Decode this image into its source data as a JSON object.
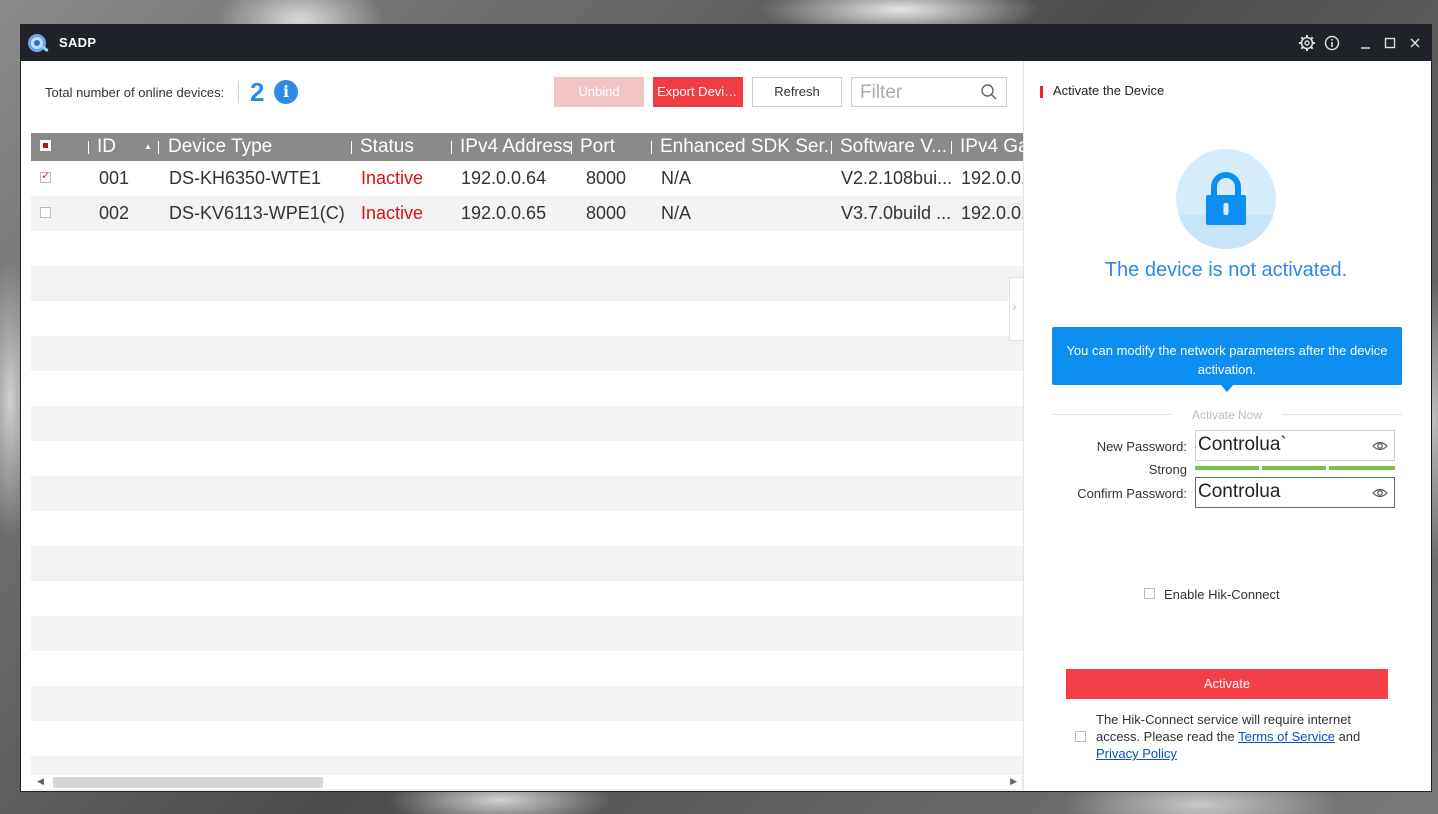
{
  "window": {
    "title": "SADP",
    "icons": [
      "gear-icon",
      "info-icon",
      "minimize-icon",
      "maximize-icon",
      "close-icon"
    ]
  },
  "toolbar": {
    "online_label": "Total number of online devices:",
    "online_count": "2",
    "unbind_label": "Unbind",
    "export_label": "Export Devic...",
    "refresh_label": "Refresh",
    "filter_placeholder": "Filter"
  },
  "table": {
    "columns": [
      "ID",
      "Device Type",
      "Status",
      "IPv4 Address",
      "Port",
      "Enhanced SDK Ser...",
      "Software V...",
      "IPv4 Ga"
    ],
    "rows": [
      {
        "checked": true,
        "id": "001",
        "device_type": "DS-KH6350-WTE1",
        "status": "Inactive",
        "ipv4": "192.0.0.64",
        "port": "8000",
        "sdk": "N/A",
        "software": "V2.2.108bui...",
        "gateway": "192.0.0."
      },
      {
        "checked": false,
        "id": "002",
        "device_type": "DS-KV6113-WPE1(C)",
        "status": "Inactive",
        "ipv4": "192.0.0.65",
        "port": "8000",
        "sdk": "N/A",
        "software": "V3.7.0build ...",
        "gateway": "192.0.0."
      }
    ]
  },
  "panel": {
    "title": "Activate the Device",
    "status_text": "The device is not activated.",
    "tip_text": "You can modify the network parameters after the device activation.",
    "activate_now_label": "Activate Now",
    "new_password_label": "New Password:",
    "new_password_value": "Controlua`",
    "strength_label": "Strong",
    "confirm_password_label": "Confirm Password:",
    "confirm_password_value": "Controlua",
    "hik_connect_label": "Enable Hik-Connect",
    "activate_button": "Activate",
    "notice_text": "The Hik-Connect service will require internet access. Please read the",
    "terms_link": "Terms of Service",
    "and_text": "and",
    "privacy_link": "Privacy Policy"
  },
  "colors": {
    "accent_blue": "#2a8ae6",
    "accent_red": "#f43f48",
    "titlebar": "#1f2329",
    "status_inactive": "#e01010",
    "strength_bar": "#7cc04f"
  }
}
